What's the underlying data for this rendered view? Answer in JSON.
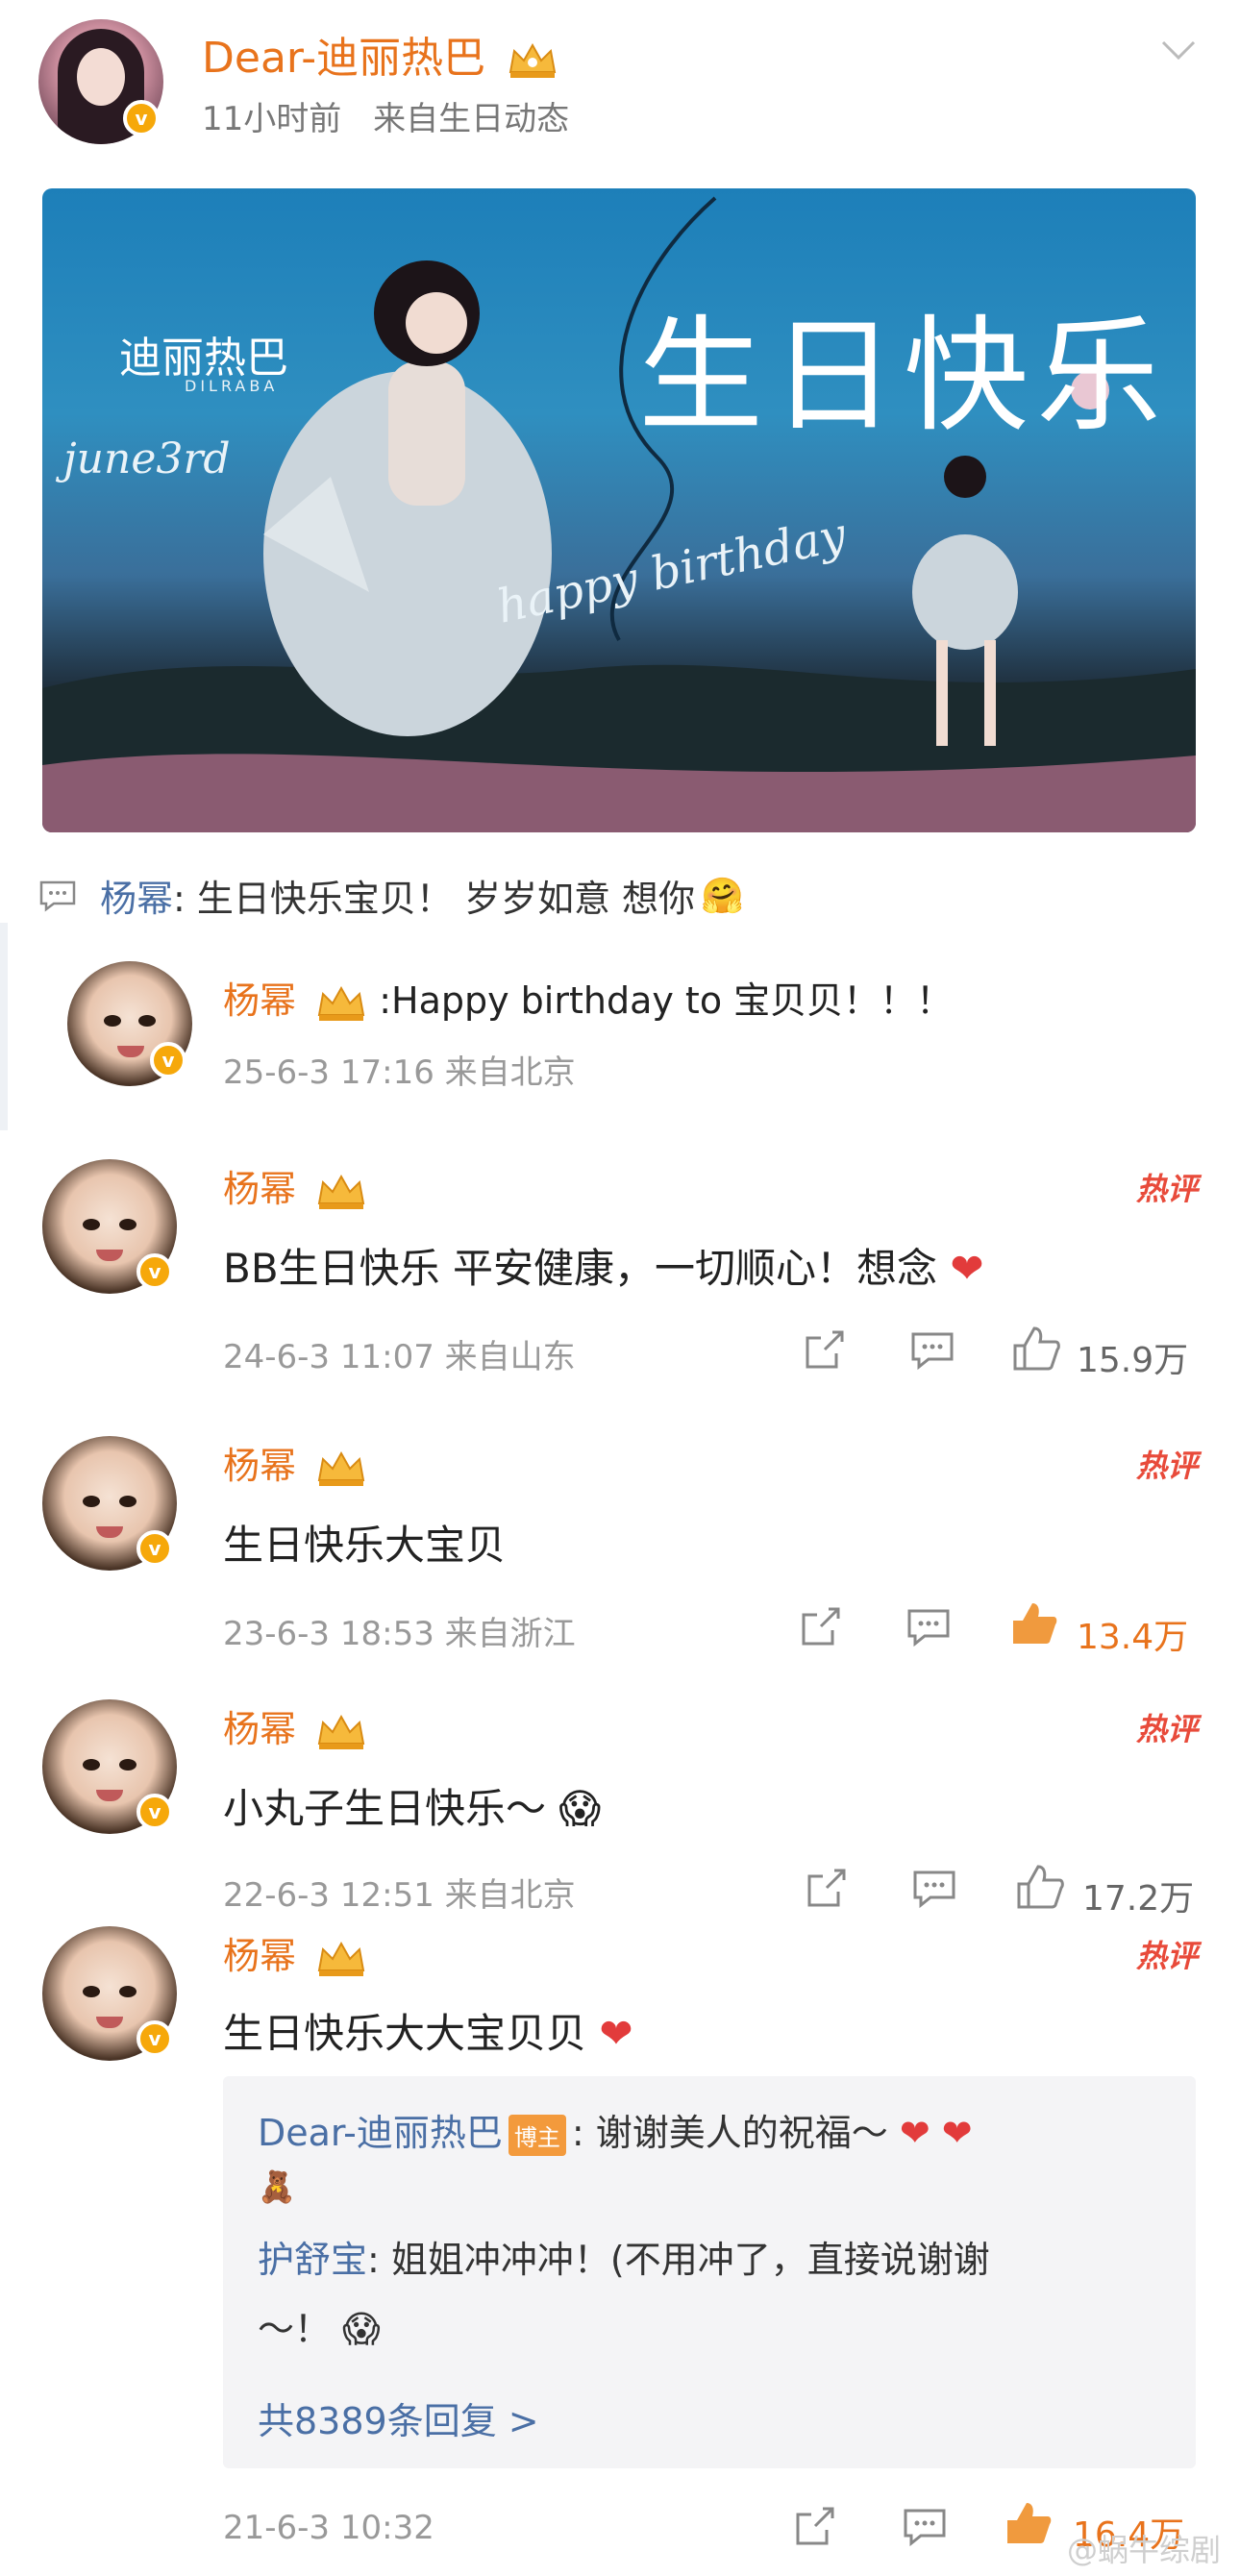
{
  "post": {
    "author": "Dear-迪丽热巴",
    "time": "11小时前",
    "source": "来自生日动态"
  },
  "banner": {
    "name": "迪丽热巴",
    "name_latin": "DILRABA",
    "june": "june3rd",
    "title": "生日快乐",
    "hb": "happy birthday"
  },
  "repost": {
    "name": "杨幂",
    "text": ": 生日快乐宝贝！ 岁岁如意 想你"
  },
  "comments": [
    {
      "name": "杨幂",
      "text": ":Happy birthday to 宝贝贝！！！",
      "meta": "25-6-3 17:16 来自北京"
    },
    {
      "name": "杨幂",
      "text": "BB生日快乐 平安健康，一切顺心！想念",
      "meta": "24-6-3 11:07 来自山东",
      "hot": "热评",
      "likes": "15.9万"
    },
    {
      "name": "杨幂",
      "text": "生日快乐大宝贝",
      "meta": "23-6-3 18:53 来自浙江",
      "hot": "热评",
      "likes": "13.4万"
    },
    {
      "name": "杨幂",
      "text": "小丸子生日快乐～",
      "meta": "22-6-3 12:51 来自北京",
      "hot": "热评",
      "likes": "17.2万"
    },
    {
      "name": "杨幂",
      "text": "生日快乐大大宝贝贝",
      "meta": "21-6-3 10:32",
      "hot": "热评",
      "likes": "16.4万"
    }
  ],
  "reply": {
    "r1_name": "Dear-迪丽热巴",
    "r1_tag": "博主",
    "r1_text": ": 谢谢美人的祝福～",
    "r2_name": "护舒宝",
    "r2_text": ": 姐姐冲冲冲！(不用冲了，直接说谢谢",
    "r2_text2": "～！",
    "more": "共8389条回复 >"
  },
  "watermark": "@蜗牛综剧",
  "colors": {
    "name": "#e8731c",
    "link": "#4a6fa5",
    "hot": "#e84a3a",
    "vip": "#f6a80a"
  }
}
